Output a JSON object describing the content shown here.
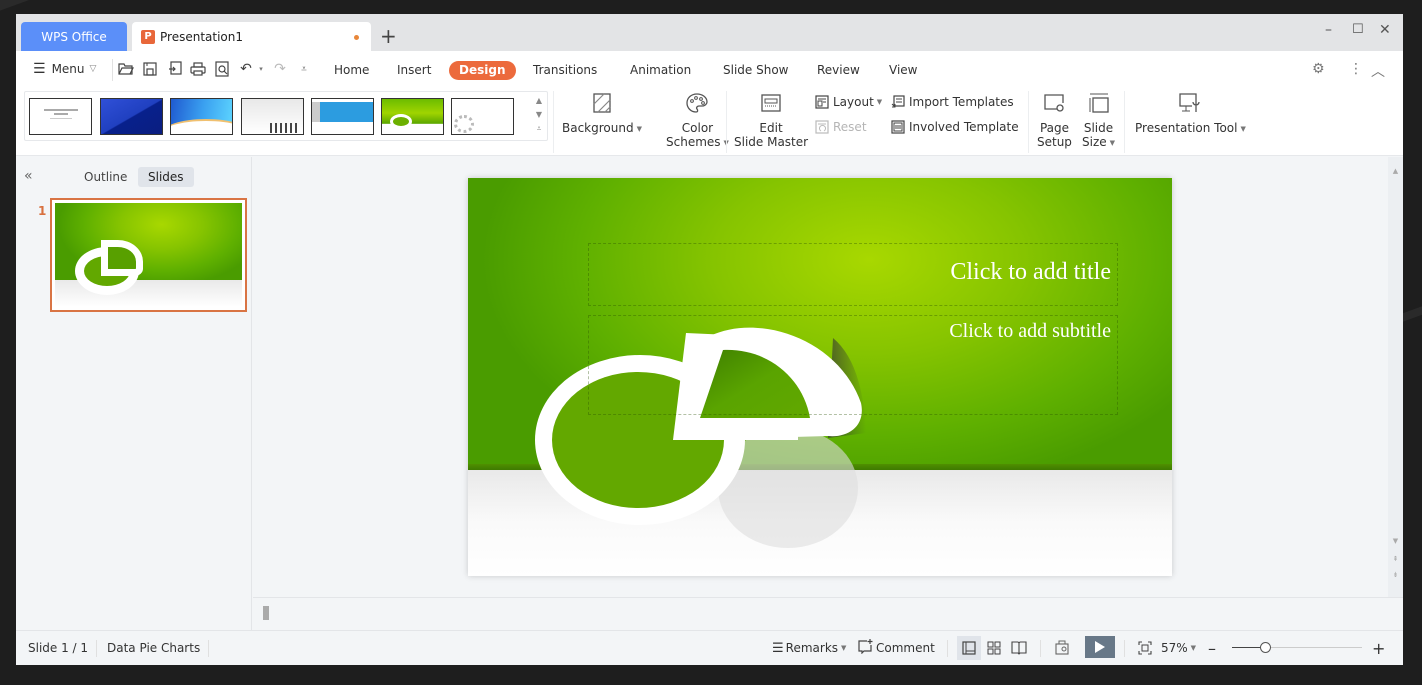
{
  "titlebar": {
    "home_tab": "WPS Office",
    "doc_tab": "Presentation1",
    "doc_icon": "P",
    "new_tab": "+",
    "minimize": "–",
    "maximize": "☐",
    "close": "✕"
  },
  "menubar": {
    "menu_label": "Menu",
    "tabs": [
      "Home",
      "Insert",
      "Design",
      "Transitions",
      "Animation",
      "Slide Show",
      "Review",
      "View"
    ],
    "active_tab": "Design"
  },
  "ribbon": {
    "background": "Background",
    "color_schemes_1": "Color",
    "color_schemes_2": "Schemes",
    "edit_master_1": "Edit",
    "edit_master_2": "Slide Master",
    "layout": "Layout",
    "reset": "Reset",
    "import_templates": "Import Templates",
    "involved_template": "Involved Template",
    "page_setup_1": "Page",
    "page_setup_2": "Setup",
    "slide_size_1": "Slide",
    "slide_size_2": "Size",
    "presentation_tool": "Presentation Tool",
    "templates": [
      "Plain white",
      "Blue diagonal",
      "Blue wave",
      "Business people",
      "Blue banner",
      "Green pie chart",
      "Gears"
    ]
  },
  "left_panel": {
    "collapse": "«",
    "tab_outline": "Outline",
    "tab_slides": "Slides",
    "active_tab": "Slides",
    "slides": [
      {
        "number": "1"
      }
    ]
  },
  "slide": {
    "title_placeholder": "Click to add title",
    "subtitle_placeholder": "Click to add subtitle"
  },
  "statusbar": {
    "slide_info": "Slide 1 / 1",
    "theme_name": "Data Pie Charts",
    "remarks": "Remarks",
    "comment": "Comment",
    "zoom_level": "57%",
    "zoom_fraction": 0.25,
    "zoom_minus": "–",
    "zoom_plus": "+"
  },
  "colors": {
    "accent": "#ec6a3c",
    "wps_blue": "#5b8ff9",
    "slide_green": "#86c400"
  }
}
